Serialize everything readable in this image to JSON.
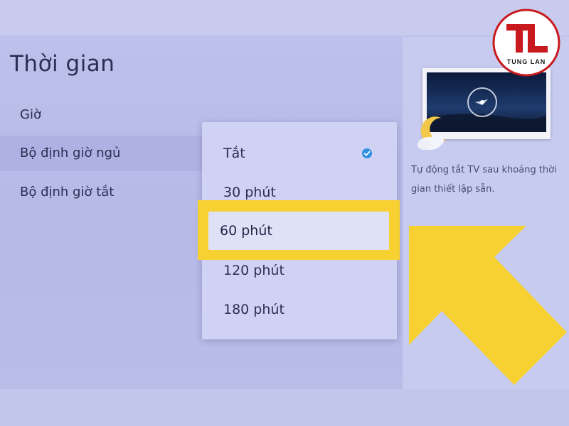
{
  "header": {
    "title": "Thời gian"
  },
  "menu": {
    "items": [
      {
        "label": "Giờ"
      },
      {
        "label": "Bộ định giờ ngủ"
      },
      {
        "label": "Bộ định giờ tắt"
      }
    ]
  },
  "dropdown": {
    "options": [
      {
        "label": "Tắt"
      },
      {
        "label": "30 phút"
      },
      {
        "label": "60 phút"
      },
      {
        "label": "120 phút"
      },
      {
        "label": "180 phút"
      }
    ],
    "checked_option": "Tắt",
    "focused_option": "60 phút"
  },
  "info": {
    "description": "Tự động tắt TV sau khoảng thời gian thiết lập sẵn."
  },
  "logo": {
    "letters": "TL",
    "brand": "TUNG LAN"
  },
  "colors": {
    "highlight": "#f6d131",
    "check": "#2f8fe0",
    "logo_red": "#c8191e"
  }
}
